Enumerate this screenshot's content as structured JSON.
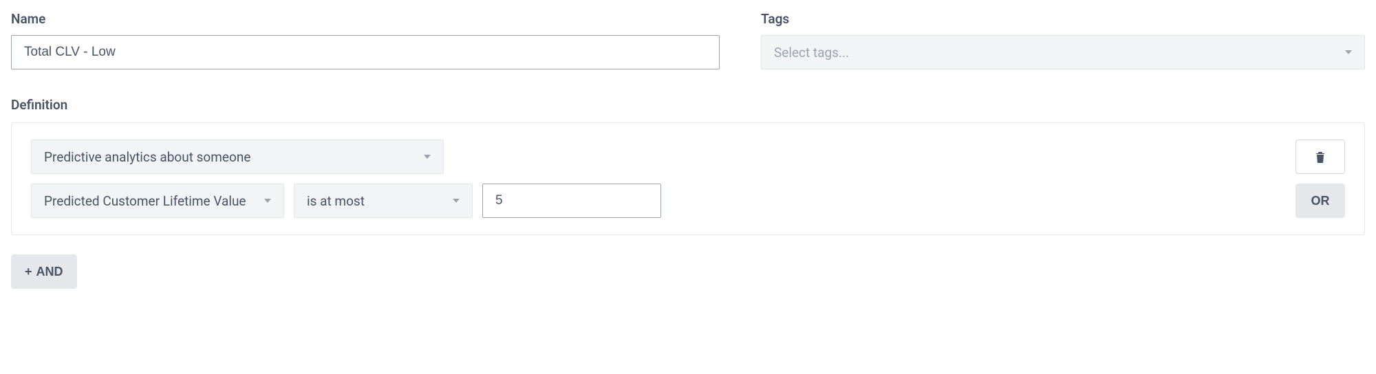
{
  "labels": {
    "name": "Name",
    "tags": "Tags",
    "definition": "Definition"
  },
  "form": {
    "name_value": "Total CLV - Low",
    "tags_placeholder": "Select tags..."
  },
  "definition": {
    "condition_type": "Predictive analytics about someone",
    "attribute": "Predicted Customer Lifetime Value",
    "operator": "is at most",
    "value": "5"
  },
  "buttons": {
    "or": "OR",
    "and": "AND"
  }
}
